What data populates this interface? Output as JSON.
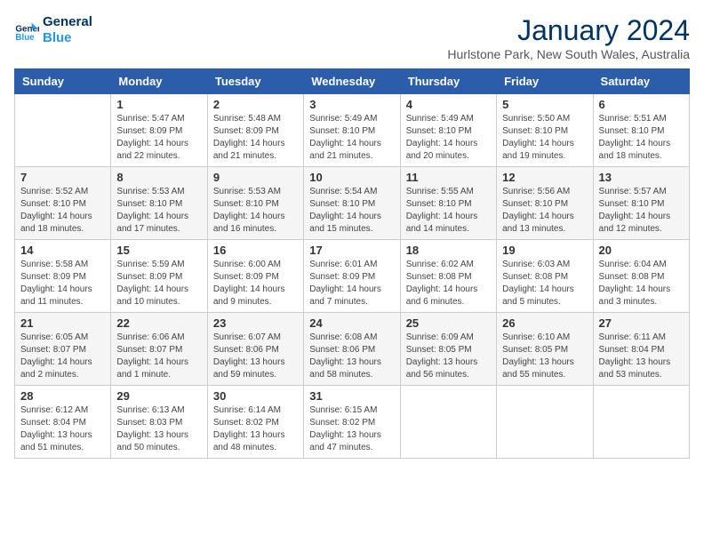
{
  "header": {
    "logo_line1": "General",
    "logo_line2": "Blue",
    "month_year": "January 2024",
    "location": "Hurlstone Park, New South Wales, Australia"
  },
  "days_of_week": [
    "Sunday",
    "Monday",
    "Tuesday",
    "Wednesday",
    "Thursday",
    "Friday",
    "Saturday"
  ],
  "weeks": [
    [
      {
        "num": "",
        "info": ""
      },
      {
        "num": "1",
        "info": "Sunrise: 5:47 AM\nSunset: 8:09 PM\nDaylight: 14 hours\nand 22 minutes."
      },
      {
        "num": "2",
        "info": "Sunrise: 5:48 AM\nSunset: 8:09 PM\nDaylight: 14 hours\nand 21 minutes."
      },
      {
        "num": "3",
        "info": "Sunrise: 5:49 AM\nSunset: 8:10 PM\nDaylight: 14 hours\nand 21 minutes."
      },
      {
        "num": "4",
        "info": "Sunrise: 5:49 AM\nSunset: 8:10 PM\nDaylight: 14 hours\nand 20 minutes."
      },
      {
        "num": "5",
        "info": "Sunrise: 5:50 AM\nSunset: 8:10 PM\nDaylight: 14 hours\nand 19 minutes."
      },
      {
        "num": "6",
        "info": "Sunrise: 5:51 AM\nSunset: 8:10 PM\nDaylight: 14 hours\nand 18 minutes."
      }
    ],
    [
      {
        "num": "7",
        "info": "Sunrise: 5:52 AM\nSunset: 8:10 PM\nDaylight: 14 hours\nand 18 minutes."
      },
      {
        "num": "8",
        "info": "Sunrise: 5:53 AM\nSunset: 8:10 PM\nDaylight: 14 hours\nand 17 minutes."
      },
      {
        "num": "9",
        "info": "Sunrise: 5:53 AM\nSunset: 8:10 PM\nDaylight: 14 hours\nand 16 minutes."
      },
      {
        "num": "10",
        "info": "Sunrise: 5:54 AM\nSunset: 8:10 PM\nDaylight: 14 hours\nand 15 minutes."
      },
      {
        "num": "11",
        "info": "Sunrise: 5:55 AM\nSunset: 8:10 PM\nDaylight: 14 hours\nand 14 minutes."
      },
      {
        "num": "12",
        "info": "Sunrise: 5:56 AM\nSunset: 8:10 PM\nDaylight: 14 hours\nand 13 minutes."
      },
      {
        "num": "13",
        "info": "Sunrise: 5:57 AM\nSunset: 8:10 PM\nDaylight: 14 hours\nand 12 minutes."
      }
    ],
    [
      {
        "num": "14",
        "info": "Sunrise: 5:58 AM\nSunset: 8:09 PM\nDaylight: 14 hours\nand 11 minutes."
      },
      {
        "num": "15",
        "info": "Sunrise: 5:59 AM\nSunset: 8:09 PM\nDaylight: 14 hours\nand 10 minutes."
      },
      {
        "num": "16",
        "info": "Sunrise: 6:00 AM\nSunset: 8:09 PM\nDaylight: 14 hours\nand 9 minutes."
      },
      {
        "num": "17",
        "info": "Sunrise: 6:01 AM\nSunset: 8:09 PM\nDaylight: 14 hours\nand 7 minutes."
      },
      {
        "num": "18",
        "info": "Sunrise: 6:02 AM\nSunset: 8:08 PM\nDaylight: 14 hours\nand 6 minutes."
      },
      {
        "num": "19",
        "info": "Sunrise: 6:03 AM\nSunset: 8:08 PM\nDaylight: 14 hours\nand 5 minutes."
      },
      {
        "num": "20",
        "info": "Sunrise: 6:04 AM\nSunset: 8:08 PM\nDaylight: 14 hours\nand 3 minutes."
      }
    ],
    [
      {
        "num": "21",
        "info": "Sunrise: 6:05 AM\nSunset: 8:07 PM\nDaylight: 14 hours\nand 2 minutes."
      },
      {
        "num": "22",
        "info": "Sunrise: 6:06 AM\nSunset: 8:07 PM\nDaylight: 14 hours\nand 1 minute."
      },
      {
        "num": "23",
        "info": "Sunrise: 6:07 AM\nSunset: 8:06 PM\nDaylight: 13 hours\nand 59 minutes."
      },
      {
        "num": "24",
        "info": "Sunrise: 6:08 AM\nSunset: 8:06 PM\nDaylight: 13 hours\nand 58 minutes."
      },
      {
        "num": "25",
        "info": "Sunrise: 6:09 AM\nSunset: 8:05 PM\nDaylight: 13 hours\nand 56 minutes."
      },
      {
        "num": "26",
        "info": "Sunrise: 6:10 AM\nSunset: 8:05 PM\nDaylight: 13 hours\nand 55 minutes."
      },
      {
        "num": "27",
        "info": "Sunrise: 6:11 AM\nSunset: 8:04 PM\nDaylight: 13 hours\nand 53 minutes."
      }
    ],
    [
      {
        "num": "28",
        "info": "Sunrise: 6:12 AM\nSunset: 8:04 PM\nDaylight: 13 hours\nand 51 minutes."
      },
      {
        "num": "29",
        "info": "Sunrise: 6:13 AM\nSunset: 8:03 PM\nDaylight: 13 hours\nand 50 minutes."
      },
      {
        "num": "30",
        "info": "Sunrise: 6:14 AM\nSunset: 8:02 PM\nDaylight: 13 hours\nand 48 minutes."
      },
      {
        "num": "31",
        "info": "Sunrise: 6:15 AM\nSunset: 8:02 PM\nDaylight: 13 hours\nand 47 minutes."
      },
      {
        "num": "",
        "info": ""
      },
      {
        "num": "",
        "info": ""
      },
      {
        "num": "",
        "info": ""
      }
    ]
  ]
}
